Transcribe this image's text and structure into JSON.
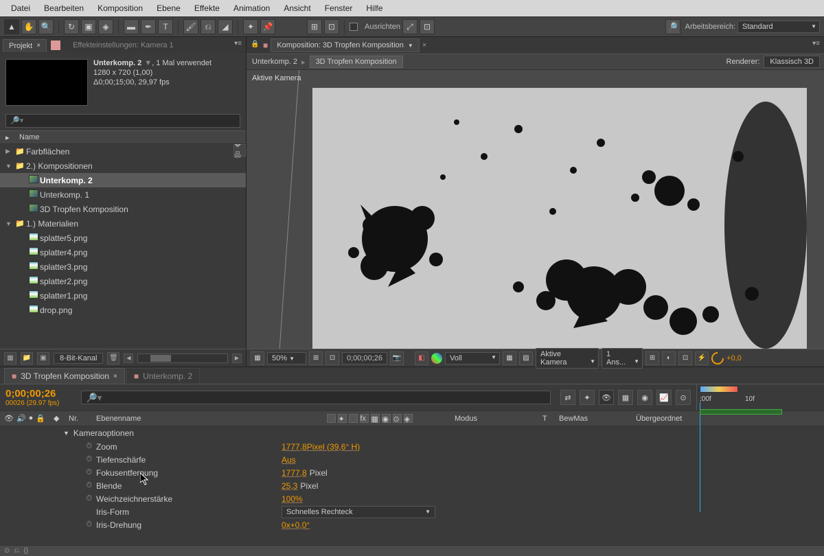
{
  "menu": [
    "Datei",
    "Bearbeiten",
    "Komposition",
    "Ebene",
    "Effekte",
    "Animation",
    "Ansicht",
    "Fenster",
    "Hilfe"
  ],
  "toolbar": {
    "align_label": "Ausrichten",
    "workspace_label": "Arbeitsbereich:",
    "workspace_value": "Standard"
  },
  "project": {
    "tab_label": "Projekt",
    "tab2_label": "Effekteinstellungen: Kamera 1",
    "comp_name": "Unterkomp. 2",
    "comp_usage": ", 1 Mal verwendet",
    "comp_res": "1280 x 720 (1,00)",
    "comp_dur": "Δ0;00;15;00, 29,97 fps",
    "name_header": "Name",
    "bitdepth": "8-Bit-Kanal",
    "items": [
      {
        "type": "folder",
        "name": "Farbflächen",
        "indent": 0,
        "open": false
      },
      {
        "type": "folder",
        "name": "2.) Kompositionen",
        "indent": 0,
        "open": true
      },
      {
        "type": "comp",
        "name": "Unterkomp. 2",
        "indent": 1,
        "sel": true
      },
      {
        "type": "comp",
        "name": "Unterkomp. 1",
        "indent": 1
      },
      {
        "type": "comp",
        "name": "3D Tropfen Komposition",
        "indent": 1
      },
      {
        "type": "folder",
        "name": "1.) Materialien",
        "indent": 0,
        "open": true
      },
      {
        "type": "img",
        "name": "splatter5.png",
        "indent": 1
      },
      {
        "type": "img",
        "name": "splatter4.png",
        "indent": 1
      },
      {
        "type": "img",
        "name": "splatter3.png",
        "indent": 1
      },
      {
        "type": "img",
        "name": "splatter2.png",
        "indent": 1
      },
      {
        "type": "img",
        "name": "splatter1.png",
        "indent": 1
      },
      {
        "type": "img",
        "name": "drop.png",
        "indent": 1
      }
    ]
  },
  "viewer": {
    "tab_label": "Komposition: 3D Tropfen Komposition",
    "breadcrumb1": "Unterkomp. 2",
    "breadcrumb2": "3D Tropfen Komposition",
    "renderer_label": "Renderer:",
    "renderer_value": "Klassisch 3D",
    "active_cam": "Aktive Kamera",
    "zoom": "50%",
    "timecode": "0;00;00;26",
    "quality": "Voll",
    "view": "Aktive Kamera",
    "views_count": "1 Ans...",
    "exposure": "+0,0"
  },
  "timeline": {
    "tab1": "3D Tropfen Komposition",
    "tab2": "Unterkomp. 2",
    "big_tc": "0;00;00;26",
    "small_tc": "00026 (29.97 fps)",
    "ruler_marks": [
      ";00f",
      "10f"
    ],
    "cols": {
      "nr": "Nr.",
      "name": "Ebenenname",
      "mode": "Modus",
      "t": "T",
      "bm": "BewMas",
      "parent": "Übergeordnet"
    },
    "cam_group": "Kameraoptionen",
    "props": [
      {
        "name": "Zoom",
        "val": "1777,8",
        "suffix": "Pixel (39,6° H)",
        "link": true
      },
      {
        "name": "Tiefenschärfe",
        "val": "Aus",
        "link": true
      },
      {
        "name": "Fokusentfernung",
        "val": "1777,8",
        "unit": "Pixel",
        "link": true
      },
      {
        "name": "Blende",
        "val": "25,3",
        "unit": "Pixel",
        "link": true
      },
      {
        "name": "Weichzeichnerstärke",
        "val": "100%",
        "link": true
      },
      {
        "name": "Iris-Form",
        "select": "Schnelles Rechteck"
      },
      {
        "name": "Iris-Drehung",
        "val": "0x+0,0°",
        "link": true
      }
    ]
  }
}
